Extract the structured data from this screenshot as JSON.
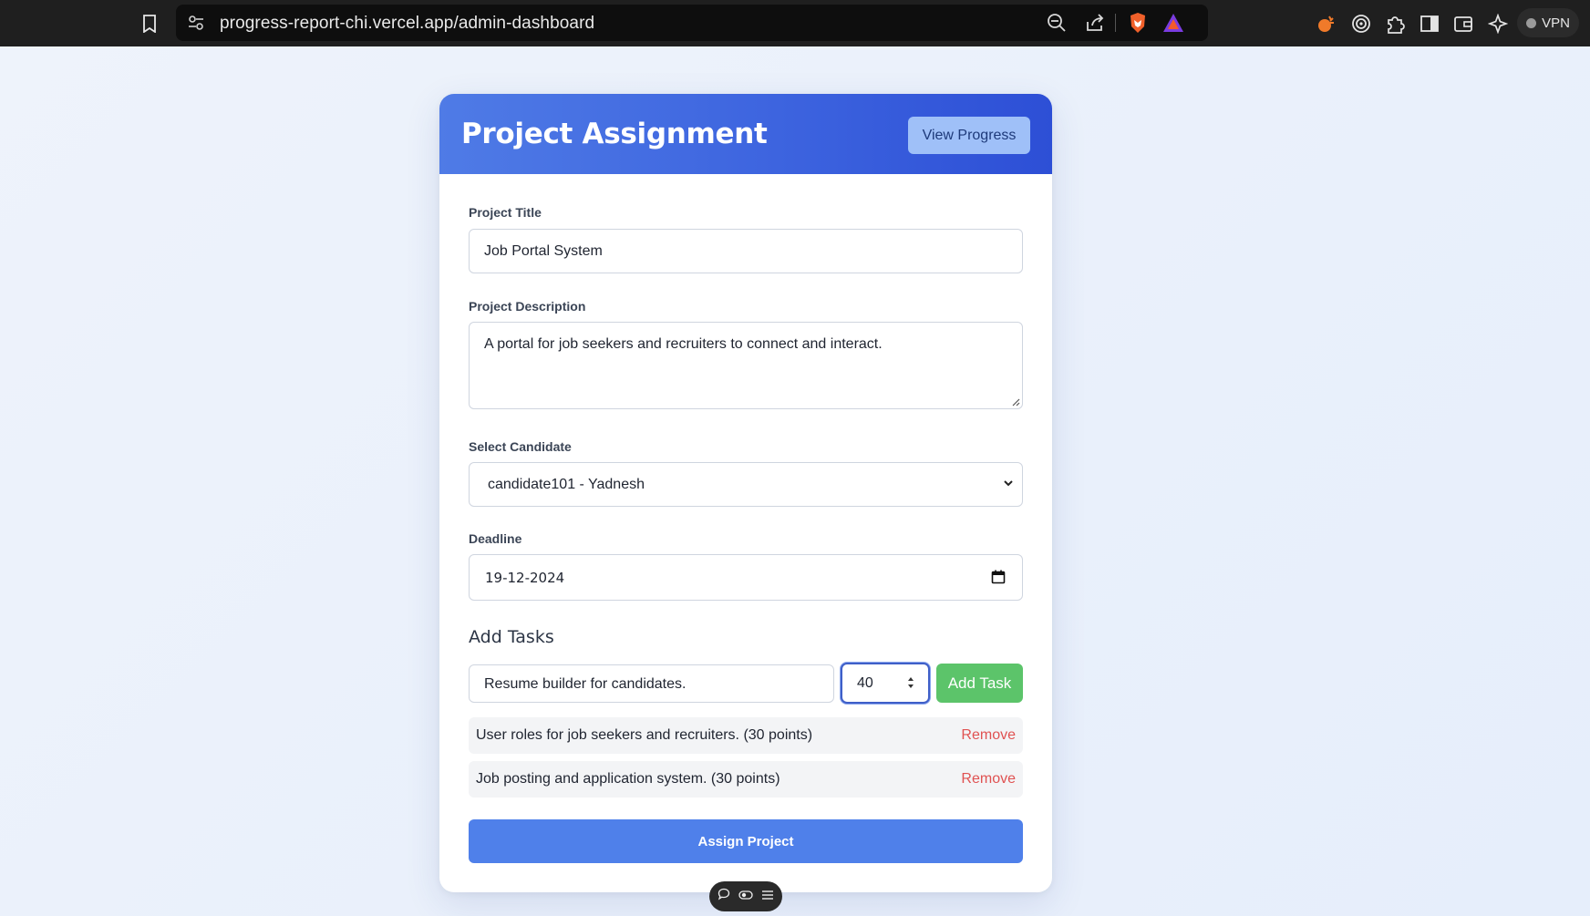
{
  "browser": {
    "url": "progress-report-chi.vercel.app/admin-dashboard",
    "vpn_label": "VPN"
  },
  "header": {
    "title": "Project Assignment",
    "view_progress_label": "View Progress"
  },
  "form": {
    "project_title": {
      "label": "Project Title",
      "value": "Job Portal System"
    },
    "project_description": {
      "label": "Project Description",
      "value": "A portal for job seekers and recruiters to connect and interact."
    },
    "candidate": {
      "label": "Select Candidate",
      "selected": "candidate101 - Yadnesh"
    },
    "deadline": {
      "label": "Deadline",
      "value": "19-12-2024"
    }
  },
  "tasks": {
    "section_title": "Add Tasks",
    "new_task_value": "Resume builder for candidates.",
    "new_task_points": "40",
    "add_label": "Add Task",
    "remove_label": "Remove",
    "items": [
      {
        "text": "User roles for job seekers and recruiters. (30 points)"
      },
      {
        "text": "Job posting and application system. (30 points)"
      }
    ]
  },
  "assign_label": "Assign Project",
  "colors": {
    "header_gradient_start": "#4f7be6",
    "header_gradient_end": "#2d4fd6",
    "add_task": "#5cc46a",
    "remove": "#e05252",
    "assign": "#4f80ea"
  }
}
